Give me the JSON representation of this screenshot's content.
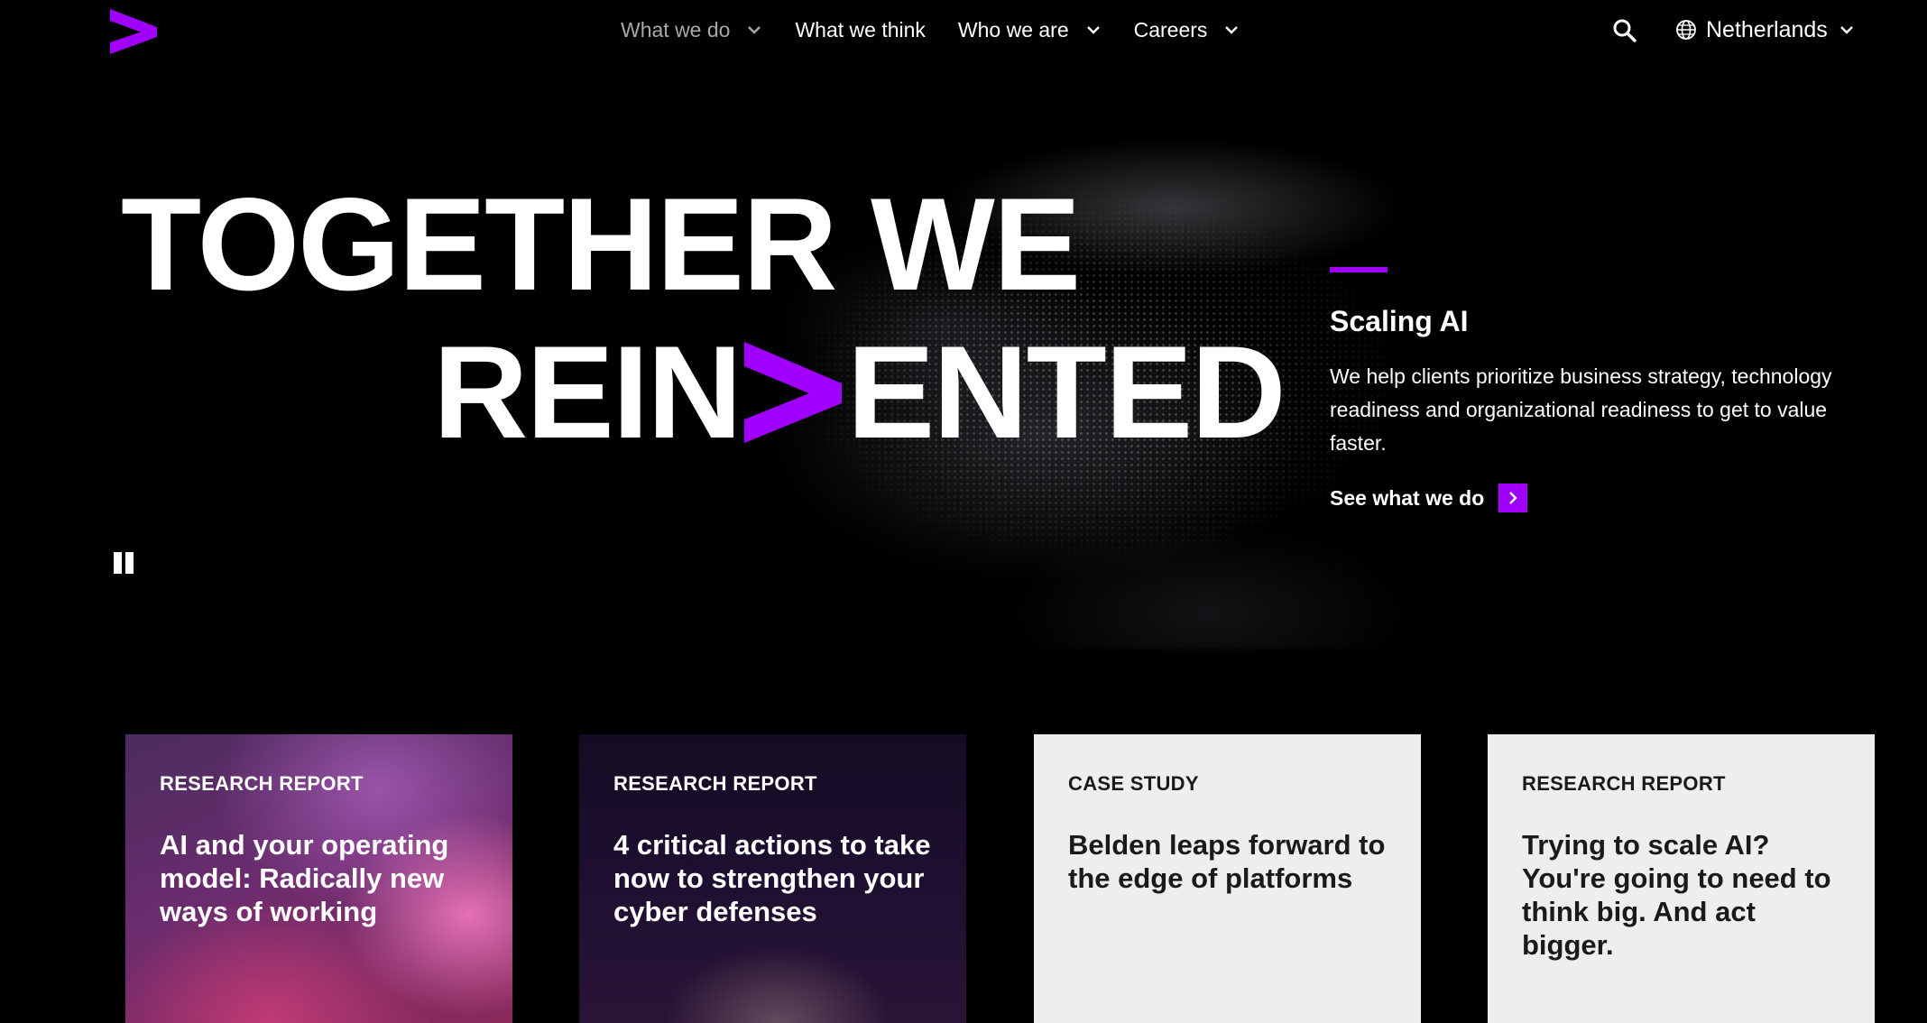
{
  "colors": {
    "accent": "#a100ff",
    "background": "#000000",
    "card_light": "#efeeec"
  },
  "header": {
    "logo_icon": "accenture-gt-logo-icon",
    "nav": [
      {
        "label": "What we do",
        "has_dropdown": true,
        "active": true
      },
      {
        "label": "What we think",
        "has_dropdown": false
      },
      {
        "label": "Who we are",
        "has_dropdown": true
      },
      {
        "label": "Careers",
        "has_dropdown": true
      }
    ],
    "search_icon": "search-icon",
    "country": {
      "icon": "globe-icon",
      "label": "Netherlands"
    }
  },
  "hero": {
    "line1": "TOGETHER WE",
    "line2_before": "REIN",
    "line2_after": "ENTED",
    "pause_icon": "pause-icon",
    "feature": {
      "title": "Scaling AI",
      "description": "We help clients prioritize business strategy, technology readiness and organizational readiness to get to value faster.",
      "link_label": "See what we do"
    }
  },
  "cards": [
    {
      "kicker": "RESEARCH REPORT",
      "title": "AI and your operating model: Radically new ways of working"
    },
    {
      "kicker": "RESEARCH REPORT",
      "title": "4 critical actions to take now to strengthen your cyber defenses"
    },
    {
      "kicker": "CASE STUDY",
      "title": "Belden leaps forward to the edge of platforms"
    },
    {
      "kicker": "RESEARCH REPORT",
      "title": "Trying to scale AI? You're going to need to think big. And act bigger."
    }
  ]
}
